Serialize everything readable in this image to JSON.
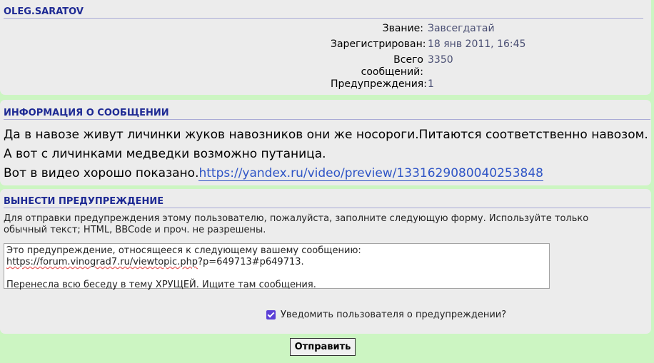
{
  "user_panel": {
    "username": "OLEG.SARATOV",
    "fields": [
      {
        "label": "Звание:",
        "value": "Завсегдатай"
      },
      {
        "label": "Зарегистрирован:",
        "value": "18 янв 2011, 16:45"
      },
      {
        "label_line1": "Всего",
        "label_line2": "сообщений:",
        "value": "3350"
      },
      {
        "label": "Предупреждения:",
        "value": "1"
      }
    ]
  },
  "message_panel": {
    "title": "ИНФОРМАЦИЯ О СООБЩЕНИИ",
    "line1": "Да в навозе живут личинки жуков навозников они же носороги.Питаются соответственно навозом.",
    "line2": "А вот с личинками медведки возможно путаница.",
    "line3_text": "Вот в видео хорошо показано.",
    "line3_link": "https://yandex.ru/video/preview/1331629080040253848"
  },
  "warning_panel": {
    "title": "ВЫНЕСТИ ПРЕДУПРЕЖДЕНИЕ",
    "description": "Для отправки предупреждения этому пользователю, пожалуйста, заполните следующую форму. Используйте только обычный текст; HTML, BBCode и проч. не разрешены.",
    "textarea_line1": "Это предупреждение, относящееся к следующему вашему сообщению:",
    "textarea_url": "https://forum.vinograd7.ru/viewtopic.php",
    "textarea_url_tail": "?p=649713#p649713.",
    "textarea_line3": "Перенесла всю беседу в тему ХРУЩЕЙ. Ищите там сообщения.",
    "notify_label": "Уведомить пользователя о предупреждении?",
    "notify_checked": true
  },
  "submit_label": "Отправить"
}
